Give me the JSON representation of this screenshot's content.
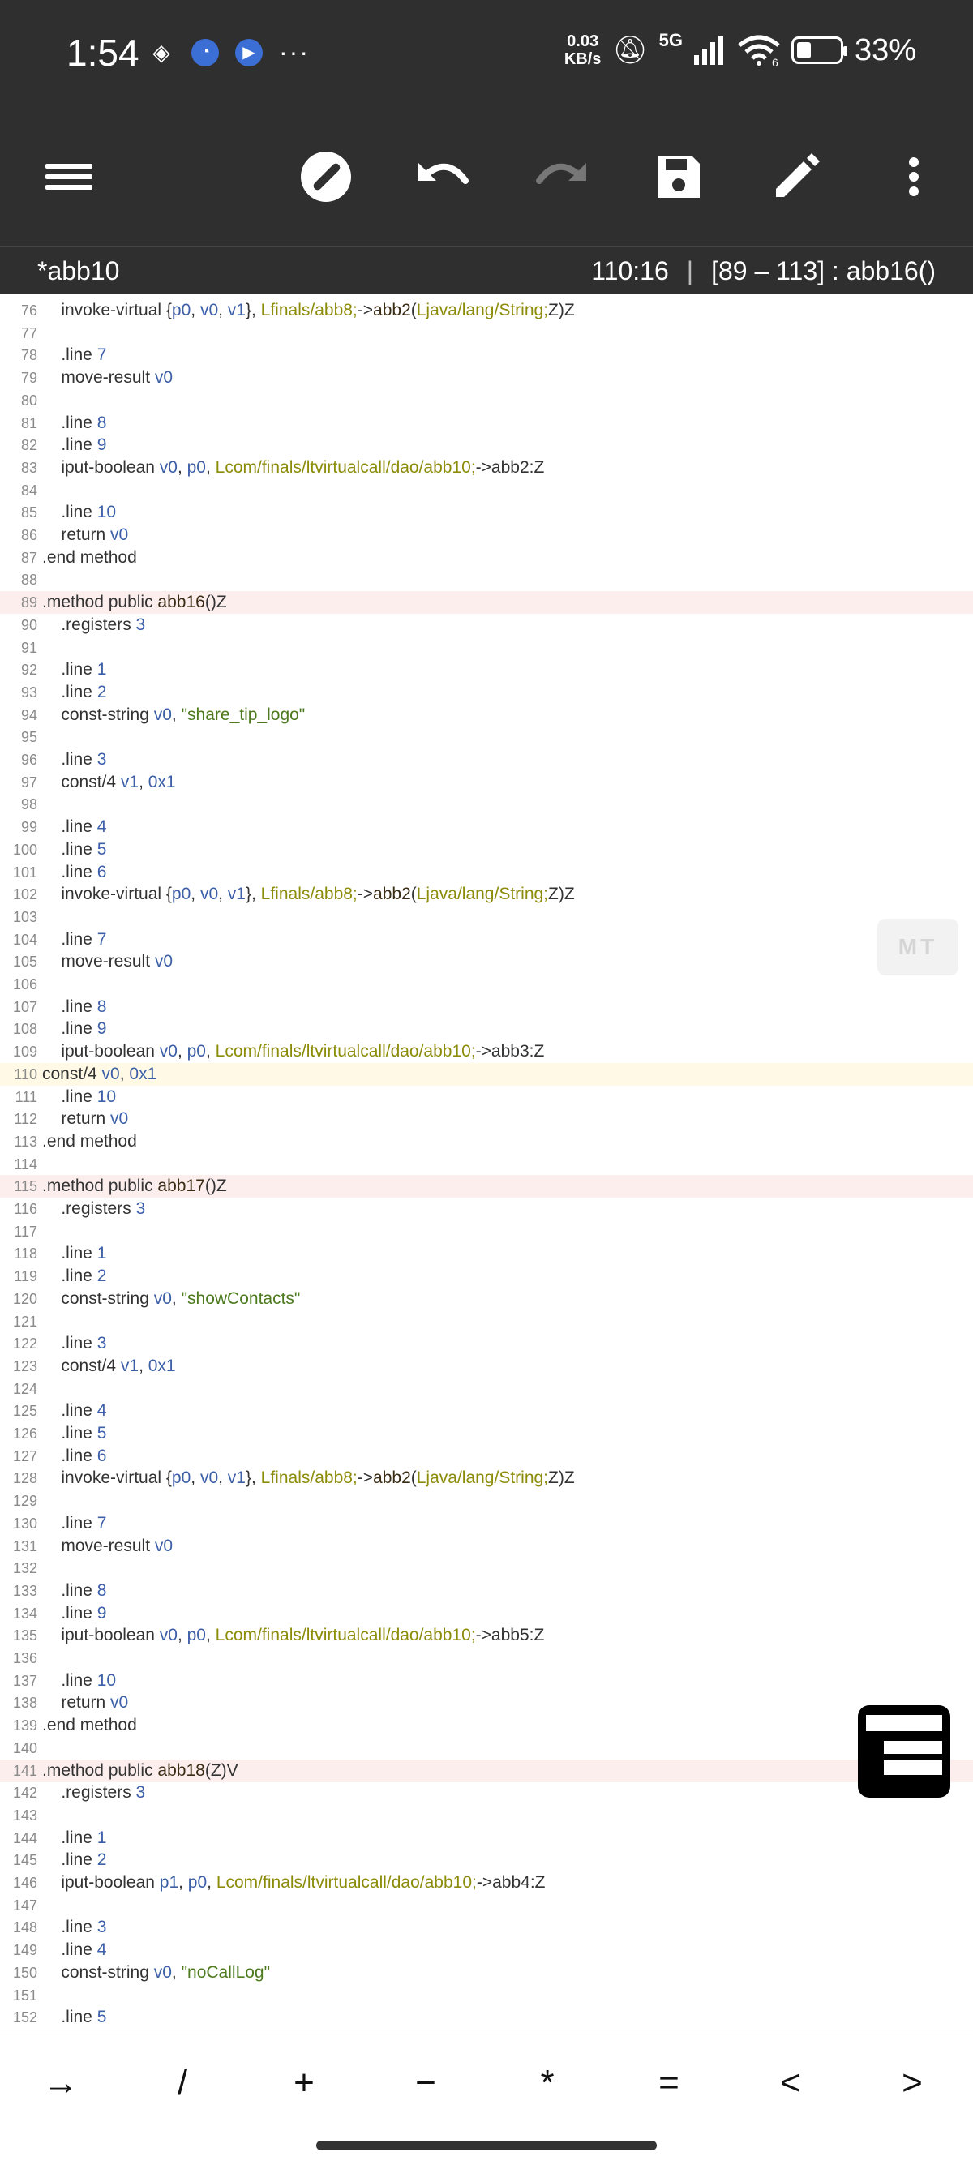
{
  "status_bar": {
    "time": "1:54",
    "net_speed_value": "0.03",
    "net_speed_unit": "KB/s",
    "network": "5G",
    "wifi_badge": "6",
    "battery_percent": "33%",
    "battery_level": 0.33
  },
  "toolbar": {
    "icons": [
      "menu-icon",
      "compass-icon",
      "undo-icon",
      "redo-icon",
      "save-icon",
      "edit-icon",
      "more-icon"
    ]
  },
  "file_bar": {
    "filename": "*abb10",
    "cursor_position": "110:16",
    "range_label": "[89 – 113] : abb16()"
  },
  "badge_text": "MT",
  "symbols": [
    "→",
    "/",
    "+",
    "−",
    "*",
    "=",
    "<",
    ">"
  ],
  "lines": [
    {
      "n": "76",
      "t": "    invoke-virtual {p0, v0, v1}, Lfinals/abb8;->abb2(Ljava/lang/String;Z)Z"
    },
    {
      "n": "77",
      "t": ""
    },
    {
      "n": "78",
      "t": "    .line 7"
    },
    {
      "n": "79",
      "t": "    move-result v0"
    },
    {
      "n": "80",
      "t": ""
    },
    {
      "n": "81",
      "t": "    .line 8"
    },
    {
      "n": "82",
      "t": "    .line 9"
    },
    {
      "n": "83",
      "t": "    iput-boolean v0, p0, Lcom/finals/ltvirtualcall/dao/abb10;->abb2:Z"
    },
    {
      "n": "84",
      "t": ""
    },
    {
      "n": "85",
      "t": "    .line 10"
    },
    {
      "n": "86",
      "t": "    return v0"
    },
    {
      "n": "87",
      "t": ".end method"
    },
    {
      "n": "88",
      "t": ""
    },
    {
      "n": "89",
      "t": ".method public abb16()Z",
      "hl": "method"
    },
    {
      "n": "90",
      "t": "    .registers 3"
    },
    {
      "n": "91",
      "t": ""
    },
    {
      "n": "92",
      "t": "    .line 1"
    },
    {
      "n": "93",
      "t": "    .line 2"
    },
    {
      "n": "94",
      "t": "    const-string v0, \"share_tip_logo\""
    },
    {
      "n": "95",
      "t": ""
    },
    {
      "n": "96",
      "t": "    .line 3"
    },
    {
      "n": "97",
      "t": "    const/4 v1, 0x1"
    },
    {
      "n": "98",
      "t": ""
    },
    {
      "n": "99",
      "t": "    .line 4"
    },
    {
      "n": "100",
      "t": "    .line 5"
    },
    {
      "n": "101",
      "t": "    .line 6"
    },
    {
      "n": "102",
      "t": "    invoke-virtual {p0, v0, v1}, Lfinals/abb8;->abb2(Ljava/lang/String;Z)Z"
    },
    {
      "n": "103",
      "t": ""
    },
    {
      "n": "104",
      "t": "    .line 7"
    },
    {
      "n": "105",
      "t": "    move-result v0"
    },
    {
      "n": "106",
      "t": ""
    },
    {
      "n": "107",
      "t": "    .line 8"
    },
    {
      "n": "108",
      "t": "    .line 9"
    },
    {
      "n": "109",
      "t": "    iput-boolean v0, p0, Lcom/finals/ltvirtualcall/dao/abb10;->abb3:Z"
    },
    {
      "n": "110",
      "t": "const/4 v0, 0x1",
      "hl": "cursor"
    },
    {
      "n": "111",
      "t": "    .line 10"
    },
    {
      "n": "112",
      "t": "    return v0"
    },
    {
      "n": "113",
      "t": ".end method"
    },
    {
      "n": "114",
      "t": ""
    },
    {
      "n": "115",
      "t": ".method public abb17()Z",
      "hl": "method"
    },
    {
      "n": "116",
      "t": "    .registers 3"
    },
    {
      "n": "117",
      "t": ""
    },
    {
      "n": "118",
      "t": "    .line 1"
    },
    {
      "n": "119",
      "t": "    .line 2"
    },
    {
      "n": "120",
      "t": "    const-string v0, \"showContacts\""
    },
    {
      "n": "121",
      "t": ""
    },
    {
      "n": "122",
      "t": "    .line 3"
    },
    {
      "n": "123",
      "t": "    const/4 v1, 0x1"
    },
    {
      "n": "124",
      "t": ""
    },
    {
      "n": "125",
      "t": "    .line 4"
    },
    {
      "n": "126",
      "t": "    .line 5"
    },
    {
      "n": "127",
      "t": "    .line 6"
    },
    {
      "n": "128",
      "t": "    invoke-virtual {p0, v0, v1}, Lfinals/abb8;->abb2(Ljava/lang/String;Z)Z"
    },
    {
      "n": "129",
      "t": ""
    },
    {
      "n": "130",
      "t": "    .line 7"
    },
    {
      "n": "131",
      "t": "    move-result v0"
    },
    {
      "n": "132",
      "t": ""
    },
    {
      "n": "133",
      "t": "    .line 8"
    },
    {
      "n": "134",
      "t": "    .line 9"
    },
    {
      "n": "135",
      "t": "    iput-boolean v0, p0, Lcom/finals/ltvirtualcall/dao/abb10;->abb5:Z"
    },
    {
      "n": "136",
      "t": ""
    },
    {
      "n": "137",
      "t": "    .line 10"
    },
    {
      "n": "138",
      "t": "    return v0"
    },
    {
      "n": "139",
      "t": ".end method"
    },
    {
      "n": "140",
      "t": ""
    },
    {
      "n": "141",
      "t": ".method public abb18(Z)V",
      "hl": "method"
    },
    {
      "n": "142",
      "t": "    .registers 3"
    },
    {
      "n": "143",
      "t": ""
    },
    {
      "n": "144",
      "t": "    .line 1"
    },
    {
      "n": "145",
      "t": "    .line 2"
    },
    {
      "n": "146",
      "t": "    iput-boolean p1, p0, Lcom/finals/ltvirtualcall/dao/abb10;->abb4:Z"
    },
    {
      "n": "147",
      "t": ""
    },
    {
      "n": "148",
      "t": "    .line 3"
    },
    {
      "n": "149",
      "t": "    .line 4"
    },
    {
      "n": "150",
      "t": "    const-string v0, \"noCallLog\""
    },
    {
      "n": "151",
      "t": ""
    },
    {
      "n": "152",
      "t": "    .line 5"
    }
  ]
}
